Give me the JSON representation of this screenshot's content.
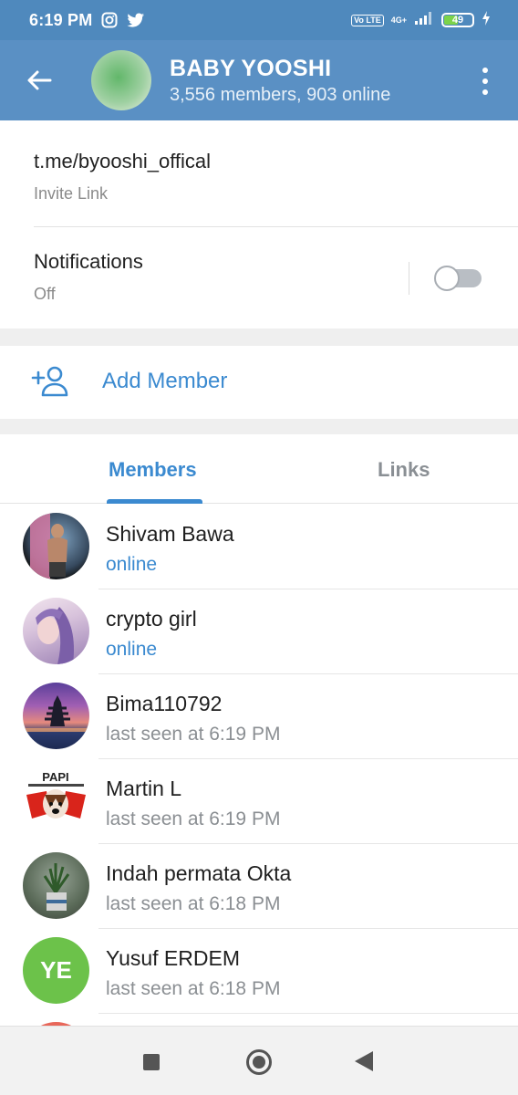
{
  "status_bar": {
    "time": "6:19 PM",
    "volte": "Vo LTE",
    "network": "4G+",
    "battery": "49"
  },
  "header": {
    "title": "BABY YOOSHI",
    "subtitle": "3,556 members, 903 online"
  },
  "info": {
    "link_value": "t.me/byooshi_offical",
    "link_label": "Invite Link",
    "notifications_label": "Notifications",
    "notifications_value": "Off",
    "notifications_enabled": false
  },
  "add_member": {
    "label": "Add Member"
  },
  "tabs": [
    {
      "label": "Members",
      "active": true
    },
    {
      "label": "Links",
      "active": false
    }
  ],
  "members": [
    {
      "name": "Shivam Bawa",
      "status": "online",
      "online": true,
      "avatar": "photo-person"
    },
    {
      "name": "crypto girl",
      "status": "online",
      "online": true,
      "avatar": "photo-girl"
    },
    {
      "name": "Bima110792",
      "status": "last seen at 6:19 PM",
      "online": false,
      "avatar": "photo-temple"
    },
    {
      "name": "Martin L",
      "status": "last seen at 6:19 PM",
      "online": false,
      "avatar": "papi-logo",
      "avatar_text": "PAPI"
    },
    {
      "name": "Indah permata Okta",
      "status": "last seen at 6:18 PM",
      "online": false,
      "avatar": "photo-plant"
    },
    {
      "name": "Yusuf ERDEM",
      "status": "last seen at 6:18 PM",
      "online": false,
      "avatar": "initials",
      "initials": "YE",
      "avatar_color": "#6cc24a"
    }
  ],
  "colors": {
    "header": "#5a90c4",
    "status_bar": "#4f89bd",
    "accent": "#3b8ad0"
  }
}
